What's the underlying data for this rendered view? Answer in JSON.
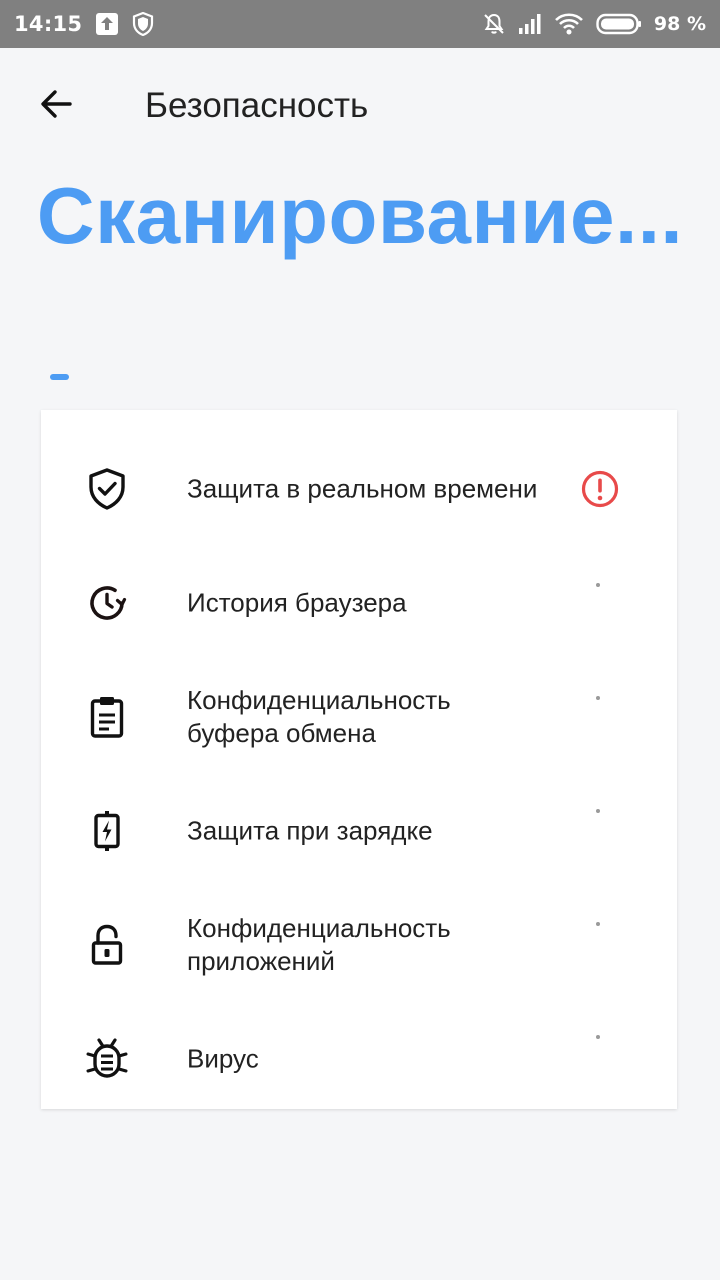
{
  "status_bar": {
    "time": "14:15",
    "battery": "98 %"
  },
  "header": {
    "title": "Безопасность"
  },
  "scan": {
    "title": "Сканирование...",
    "progress_fraction": 0.03
  },
  "colors": {
    "accent": "#4d9cf3",
    "warning": "#e84a4a",
    "status_bar_bg": "#808080",
    "page_bg": "#f5f6f8"
  },
  "items": [
    {
      "label": "Защита в реальном времени",
      "icon": "shield-check-icon",
      "status": "warning"
    },
    {
      "label": "История браузера",
      "icon": "history-clock-icon",
      "status": "pending"
    },
    {
      "label": "Конфиденциальность буфера обмена",
      "icon": "clipboard-icon",
      "status": "pending"
    },
    {
      "label": "Защита при зарядке",
      "icon": "battery-charging-icon",
      "status": "pending"
    },
    {
      "label": "Конфиденциальность приложений",
      "icon": "lock-open-icon",
      "status": "pending"
    },
    {
      "label": "Вирус",
      "icon": "bug-icon",
      "status": "pending"
    }
  ]
}
